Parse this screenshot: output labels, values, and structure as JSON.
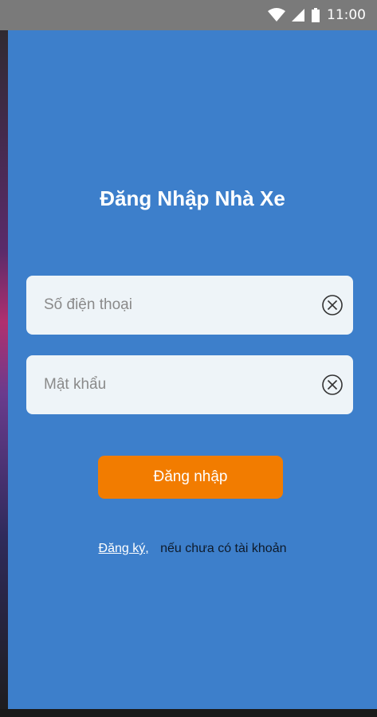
{
  "status_bar": {
    "time": "11:00",
    "icons": [
      "wifi-icon",
      "signal-icon",
      "battery-icon"
    ]
  },
  "page": {
    "title": "Đăng Nhập Nhà Xe"
  },
  "form": {
    "phone": {
      "placeholder": "Số điện thoại",
      "value": ""
    },
    "password": {
      "placeholder": "Mật khẩu",
      "value": ""
    },
    "login_label": "Đăng nhập"
  },
  "register": {
    "link_label": "Đăng ký,",
    "text": "nếu chưa có tài khoản"
  },
  "colors": {
    "background": "#3d7fcb",
    "button": "#f27c00",
    "field": "#eef4f8"
  }
}
